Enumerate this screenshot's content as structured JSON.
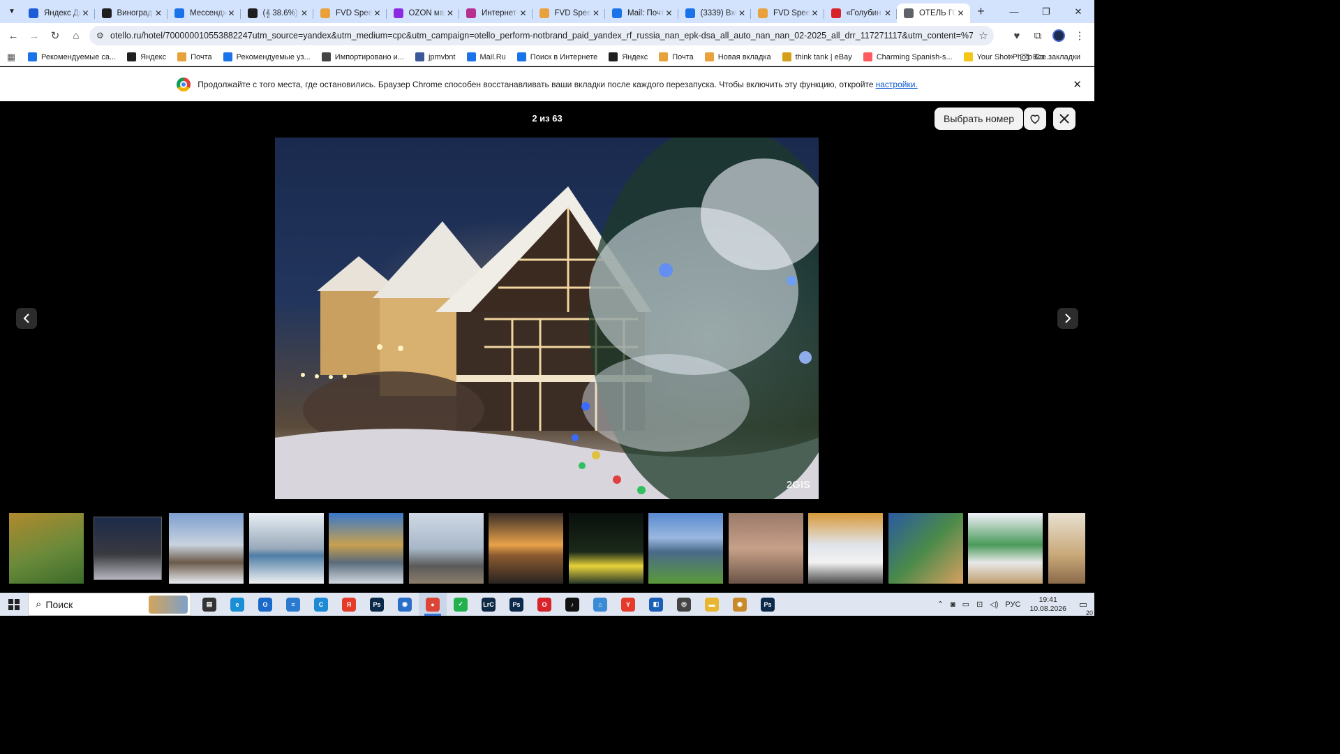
{
  "browser": {
    "tabs": [
      {
        "title": "Яндекс Ди",
        "icon": "yandex-disk-icon",
        "color": "#1e5bd6"
      },
      {
        "title": "Виноград",
        "icon": "w-icon",
        "color": "#1f1f1f"
      },
      {
        "title": "Мессендж",
        "icon": "messenger-icon",
        "color": "#1a73e8"
      },
      {
        "title": "(𝄞 38.6%)",
        "icon": "w-icon",
        "color": "#1f1f1f"
      },
      {
        "title": "FVD Speed",
        "icon": "house-icon",
        "color": "#e9a23b"
      },
      {
        "title": "OZON мар",
        "icon": "ozon-icon",
        "color": "#8a2be2"
      },
      {
        "title": "Интернет-",
        "icon": "wb-icon",
        "color": "#b7308f"
      },
      {
        "title": "FVD Speed",
        "icon": "house-icon",
        "color": "#e9a23b"
      },
      {
        "title": "Mail: Почт",
        "icon": "at-icon",
        "color": "#1a73e8"
      },
      {
        "title": "(3339) Вхо",
        "icon": "mail-icon",
        "color": "#1a73e8"
      },
      {
        "title": "FVD Speed",
        "icon": "house-icon",
        "color": "#e9a23b"
      },
      {
        "title": "«Голубин",
        "icon": "yandex-icon",
        "color": "#d8232a"
      },
      {
        "title": "ОТЕЛЬ ГО",
        "icon": "globe-icon",
        "color": "#5f6368"
      }
    ],
    "active_tab_index": 12,
    "url": "otello.ru/hotel/700000010553882247utm_source=yandex&utm_medium=cpc&utm_campaign=otello_perform-notbrand_paid_yandex_rf_russia_nan_epk-dsa_all_auto_nan_nan_02-2025_all_drr_117271117&utm_content=%7Cgbid%7C57403779...",
    "bookmarks": [
      {
        "label": "Рекомендуемые са...",
        "icon": "search-icon",
        "color": "#1a73e8"
      },
      {
        "label": "Яндекс",
        "icon": "yandex-icon",
        "color": "#1f1f1f"
      },
      {
        "label": "Почта",
        "icon": "mail-icon",
        "color": "#e8a23b"
      },
      {
        "label": "Рекомендуемые уз...",
        "icon": "search-icon",
        "color": "#1a73e8"
      },
      {
        "label": "Импортировано и...",
        "icon": "folder-icon",
        "color": "#444444"
      },
      {
        "label": "jpmvbnt",
        "icon": "b-icon",
        "color": "#3b5998"
      },
      {
        "label": "Mail.Ru",
        "icon": "at-icon",
        "color": "#1a73e8"
      },
      {
        "label": "Поиск в Интернете",
        "icon": "at-icon",
        "color": "#1a73e8"
      },
      {
        "label": "Яндекс",
        "icon": "yandex-icon",
        "color": "#1f1f1f"
      },
      {
        "label": "Почта",
        "icon": "mail-icon",
        "color": "#e8a23b"
      },
      {
        "label": "Новая вкладка",
        "icon": "house-icon",
        "color": "#e9a23b"
      },
      {
        "label": "think tank | eBay",
        "icon": "shop-icon",
        "color": "#d4a017"
      },
      {
        "label": "Charming Spanish-s...",
        "icon": "airbnb-icon",
        "color": "#ff5a5f"
      },
      {
        "label": "Your Shot Photo Co...",
        "icon": "natgeo-icon",
        "color": "#f5c518"
      }
    ],
    "all_bookmarks": "Все закладки"
  },
  "infobar": {
    "text": "Продолжайте с того места, где остановились. Браузер Chrome способен восстанавливать ваши вкладки после каждого перезапуска. Чтобы включить эту функцию, откройте",
    "link": "настройки."
  },
  "gallery": {
    "counter": "2 из 63",
    "choose_room": "Выбрать номер",
    "watermark": "2GIS",
    "thumbnails": [
      {
        "bg": "linear-gradient(160deg,#b08a2e,#6a8a3a 55%,#3b6b2a)"
      },
      {
        "bg": "linear-gradient(180deg,#1b2b48,#3a3a40 60%,#b7b7c0)",
        "active": true
      },
      {
        "bg": "linear-gradient(180deg,#7da0d0,#c9d2de 45%,#6b5a4a 70%,#e9ecf1)"
      },
      {
        "bg": "linear-gradient(180deg,#e8eef4,#9ab 50%,#4f7ea6 60%,#f1f1f1)"
      },
      {
        "bg": "linear-gradient(180deg,#3a78c8,#c8a050 45%,#5a6b7a 70%,#d0d8e0)"
      },
      {
        "bg": "linear-gradient(180deg,#cfd8e4,#a8b8c8 50%,#5a5a5a 75%,#8b7d6b)"
      },
      {
        "bg": "linear-gradient(180deg,#3a2f28,#e9a24a 45%,#8a5a30 60%,#2a2420)"
      },
      {
        "bg": "linear-gradient(180deg,#0a0f0c,#1a2a1a 55%,#e8d23a 75%,#2a3a2a)"
      },
      {
        "bg": "linear-gradient(180deg,#5a8ad0,#9ab8e0 35%,#4a6a8a 55%,#5a9a3a)"
      },
      {
        "bg": "linear-gradient(180deg,#9a7a6a,#c8a088 50%,#6a5448)"
      },
      {
        "bg": "linear-gradient(180deg,#d89a3a,#e0e4ea 45%,#f2f2f2 70%,#4a4a4a)"
      },
      {
        "bg": "linear-gradient(135deg,#2a5aa0,#4a8a4a 50%,#d8a060)"
      },
      {
        "bg": "linear-gradient(180deg,#f0f0f8,#4a9a5a 45%,#e8e8e8 70%,#c0a070)"
      },
      {
        "bg": "linear-gradient(180deg,#e8e0d0,#c8a878 60%,#8a6a4a)"
      }
    ]
  },
  "taskbar": {
    "search_placeholder": "Поиск",
    "apps": [
      {
        "icon": "task-view-icon",
        "color": "#333333",
        "glyph": "▤"
      },
      {
        "icon": "edge-icon",
        "color": "#1a8fd6",
        "glyph": "e"
      },
      {
        "icon": "outlook-icon",
        "color": "#1b6ac9",
        "glyph": "O"
      },
      {
        "icon": "stack-icon",
        "color": "#2a7ad0",
        "glyph": "≡"
      },
      {
        "icon": "c-app-icon",
        "color": "#1e8ad6",
        "glyph": "C"
      },
      {
        "icon": "yandex-browser-icon",
        "color": "#e53b2b",
        "glyph": "Я"
      },
      {
        "icon": "photoshop-icon",
        "color": "#0b2a4a",
        "glyph": "Ps"
      },
      {
        "icon": "camera-icon",
        "color": "#2a70c8",
        "glyph": "◉"
      },
      {
        "icon": "chrome-icon",
        "color": "#db4437",
        "glyph": "●",
        "active": true
      },
      {
        "icon": "green-app-icon",
        "color": "#23b14d",
        "glyph": "✓"
      },
      {
        "icon": "lightroom-icon",
        "color": "#0f2a45",
        "glyph": "LrC"
      },
      {
        "icon": "photoshop-icon",
        "color": "#0b2a4a",
        "glyph": "Ps"
      },
      {
        "icon": "opera-icon",
        "color": "#d8232a",
        "glyph": "O"
      },
      {
        "icon": "tiktok-icon",
        "color": "#111111",
        "glyph": "♪"
      },
      {
        "icon": "scan-app-icon",
        "color": "#3a8ad6",
        "glyph": "⌂"
      },
      {
        "icon": "yandex-icon",
        "color": "#e53b2b",
        "glyph": "Y"
      },
      {
        "icon": "blue-app-icon",
        "color": "#1b5fb8",
        "glyph": "◧"
      },
      {
        "icon": "circle-app-icon",
        "color": "#444444",
        "glyph": "◎"
      },
      {
        "icon": "explorer-icon",
        "color": "#e8b630",
        "glyph": "▬"
      },
      {
        "icon": "viewer-app-icon",
        "color": "#c88a2a",
        "glyph": "◉"
      },
      {
        "icon": "photoshop-icon",
        "color": "#0b2a4a",
        "glyph": "Ps"
      }
    ],
    "language": "РУС",
    "time": "19:41",
    "date": "10.08.2026",
    "notifications": "20"
  }
}
